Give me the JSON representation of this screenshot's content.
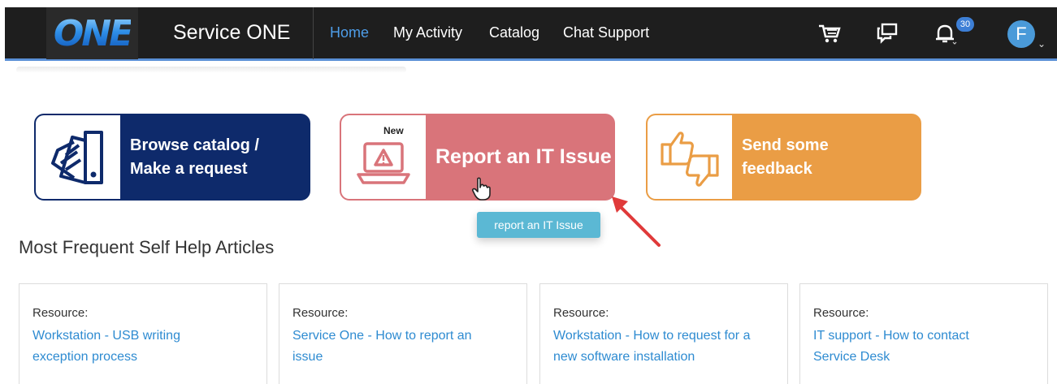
{
  "header": {
    "logo_text": "ONE",
    "app_title": "Service ONE",
    "nav": [
      {
        "label": "Home",
        "active": true
      },
      {
        "label": "My Activity",
        "active": false
      },
      {
        "label": "Catalog",
        "active": false
      },
      {
        "label": "Chat Support",
        "active": false
      }
    ],
    "icons": [
      "cart-icon",
      "chat-icon",
      "bell-icon"
    ],
    "notification_count": "30",
    "avatar_initial": "F"
  },
  "tiles": [
    {
      "label": "Browse catalog / Make a request",
      "icon": "catalog-swatch-icon",
      "color": "#0e2a6b"
    },
    {
      "label": "Report an IT Issue",
      "icon": "laptop-warning-icon",
      "color": "#d9747a",
      "tag": "New"
    },
    {
      "label": "Send some feedback",
      "icon": "thumbs-up-down-icon",
      "color": "#ea9d45"
    }
  ],
  "tooltip": "report an IT Issue",
  "section_title": "Most Frequent Self Help Articles",
  "articles": [
    {
      "label": "Resource:",
      "title": "Workstation - USB writing exception process"
    },
    {
      "label": "Resource:",
      "title": "Service One - How to report an issue"
    },
    {
      "label": "Resource:",
      "title": "Workstation - How to request for a new software installation"
    },
    {
      "label": "Resource:",
      "title": "IT support - How to contact Service Desk"
    }
  ],
  "colors": {
    "nav_bg": "#1e1e1e",
    "accent": "#4e9de8",
    "link": "#2e8bd1"
  }
}
